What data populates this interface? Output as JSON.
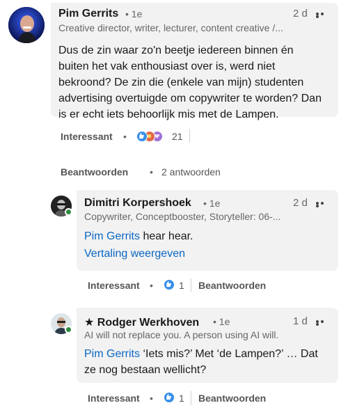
{
  "comment": {
    "author": "Pim Gerrits",
    "degree": "• 1e",
    "time": "2 d",
    "headline": "Creative director, writer, lecturer, content creative /...",
    "text": "Dus de zin waar zo'n beetje iedereen binnen én buiten het vak enthousiast over is, werd niet bekroond? De zin die (enkele van mijn) studenten advertising overtuigde om copywriter te worden? Dan is er echt iets behoorlijk mis met de Lampen.",
    "like_label": "Interessant",
    "dot": "•",
    "reaction_count": "21",
    "reply_label": "Beantwoorden",
    "replies_count": "2 antwoorden"
  },
  "replies": [
    {
      "author": "Dimitri Korpershoek",
      "degree": "• 1e",
      "time": "2 d",
      "headline": "Copywriter, Conceptbooster, Storyteller: 06-...",
      "mention": "Pim Gerrits",
      "text": " hear hear.",
      "translate": "Vertaling weergeven",
      "like_label": "Interessant",
      "dot": "•",
      "reaction_count": "1",
      "reply_label": "Beantwoorden"
    },
    {
      "star": "★",
      "author": "Rodger Werkhoven",
      "degree": "• 1e",
      "time": "1 d",
      "headline": "AI will not replace you. A person using AI will.",
      "mention": "Pim Gerrits",
      "text": " ‘Iets mis?’ Met ‘de Lampen?’ … Dat ze nog bestaan wellicht?",
      "like_label": "Interessant",
      "dot": "•",
      "reaction_count": "1",
      "reply_label": "Beantwoorden"
    }
  ],
  "icons": {
    "like": "thumbs-up-icon",
    "celebrate": "celebrate-icon",
    "support": "heart-icon",
    "more": "more-icon"
  },
  "colors": {
    "link": "#0a66c2",
    "bubble": "#f2f2f2",
    "like_blue": "#378fe9",
    "online": "#2e8a3e"
  }
}
